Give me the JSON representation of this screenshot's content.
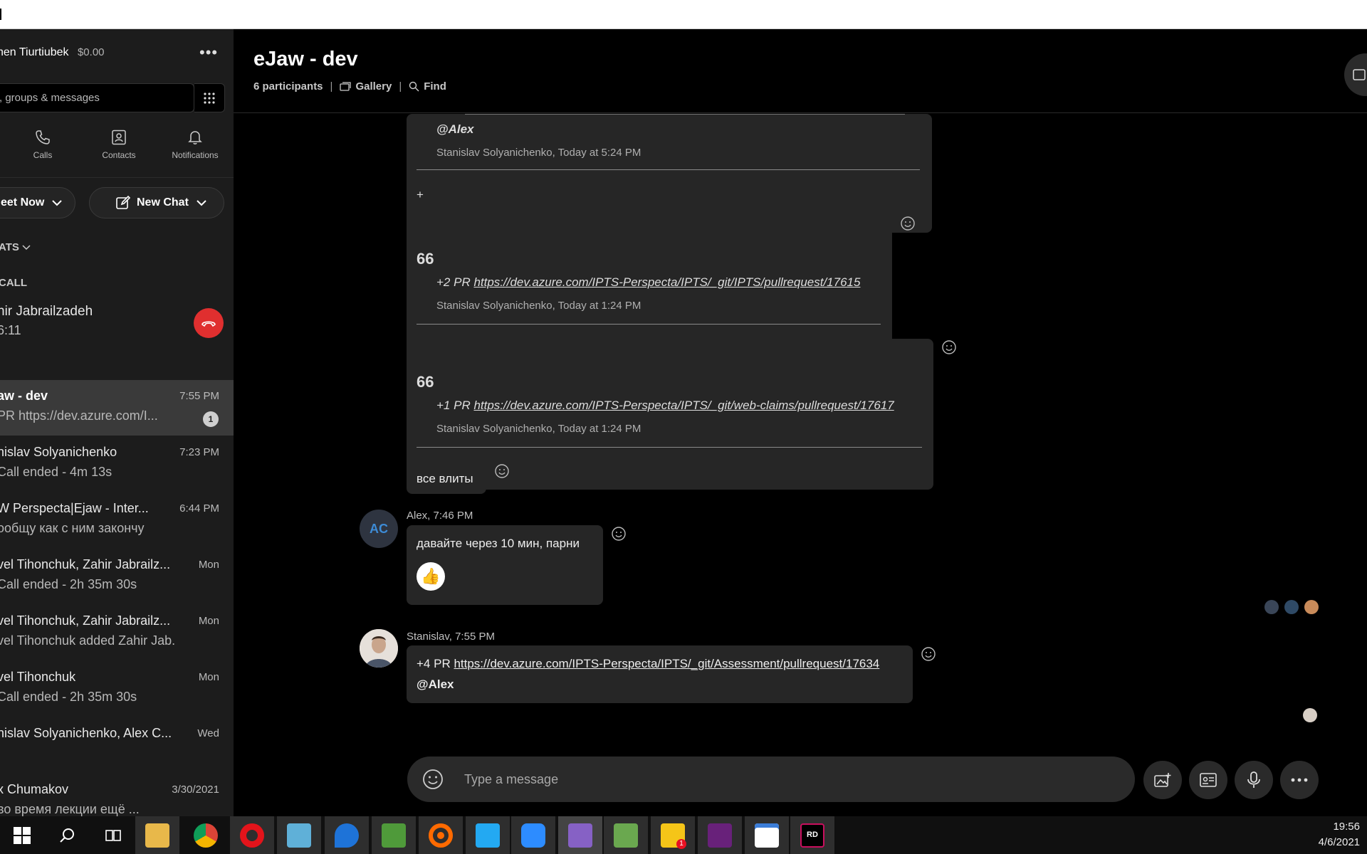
{
  "sidebar": {
    "profile_name": "hen Tiurtiubek",
    "balance": "$0.00",
    "more_label": "•••",
    "search_placeholder": ", groups & messages",
    "nav": {
      "calls": "Calls",
      "contacts": "Contacts",
      "notifications": "Notifications"
    },
    "meet_now": "eet Now",
    "new_chat": "New Chat",
    "chats_header": "ATS",
    "call_header": "CALL",
    "active_call": {
      "name": "hir Jabrailzadeh",
      "duration": "6:11"
    },
    "chats": [
      {
        "name": "aw - dev",
        "time": "7:55 PM",
        "preview": "PR https://dev.azure.com/I...",
        "badge": "1"
      },
      {
        "name": "nislav Solyanichenko",
        "time": "7:23 PM",
        "preview": "Call ended - 4m 13s"
      },
      {
        "name": "W Perspecta|Ejaw - Inter...",
        "time": "6:44 PM",
        "preview": "ообщу как с ним закончу"
      },
      {
        "name": "vel Tihonchuk, Zahir Jabrailz...",
        "time": "Mon",
        "preview": "Call ended - 2h 35m 30s"
      },
      {
        "name": "vel Tihonchuk, Zahir Jabrailz...",
        "time": "Mon",
        "preview": "vel Tihonchuk added Zahir Jab..."
      },
      {
        "name": "vel Tihonchuk",
        "time": "Mon",
        "preview": "Call ended - 2h 35m 30s"
      },
      {
        "name": "nislav Solyanichenko, Alex C...",
        "time": "Wed",
        "preview": ""
      },
      {
        "name": "x Chumakov",
        "time": "3/30/2021",
        "preview": " во время лекции ещё ..."
      }
    ]
  },
  "header": {
    "title": "eJaw - dev",
    "participants": "6 participants",
    "sep": "|",
    "gallery": "Gallery",
    "find": "Find"
  },
  "messages": {
    "q1_mention": "@Alex",
    "q1_meta": "Stanislav Solyanichenko, Today at 5:24 PM",
    "plus": "+",
    "quote_mark": "66",
    "q2_prefix": "+2 PR ",
    "q2_link": "https://dev.azure.com/IPTS-Perspecta/IPTS/_git/IPTS/pullrequest/17615",
    "q2_meta": "Stanislav Solyanichenko, Today at 1:24 PM",
    "q3_prefix": "+1 PR ",
    "q3_link": "https://dev.azure.com/IPTS-Perspecta/IPTS/_git/web-claims/pullrequest/17617",
    "q3_meta": "Stanislav Solyanichenko, Today at 1:24 PM",
    "vse_vlity": "все влиты",
    "alex_sender": "Alex, 7:46 PM",
    "alex_initials": "AC",
    "alex_text": "давайте через 10 мин, парни",
    "stan_sender": "Stanislav, 7:55 PM",
    "stan_prefix": "+4 PR ",
    "stan_link": "https://dev.azure.com/IPTS-Perspecta/IPTS/_git/Assessment/pullrequest/17634",
    "stan_mention": "@Alex"
  },
  "composer": {
    "placeholder": "Type a message"
  },
  "taskbar": {
    "time": "19:56",
    "date": "4/6/2021",
    "skype_badge": "1",
    "rider_label": "RD"
  },
  "colors": {
    "accent": "#3d8bd6",
    "hangup": "#e02f2f"
  }
}
